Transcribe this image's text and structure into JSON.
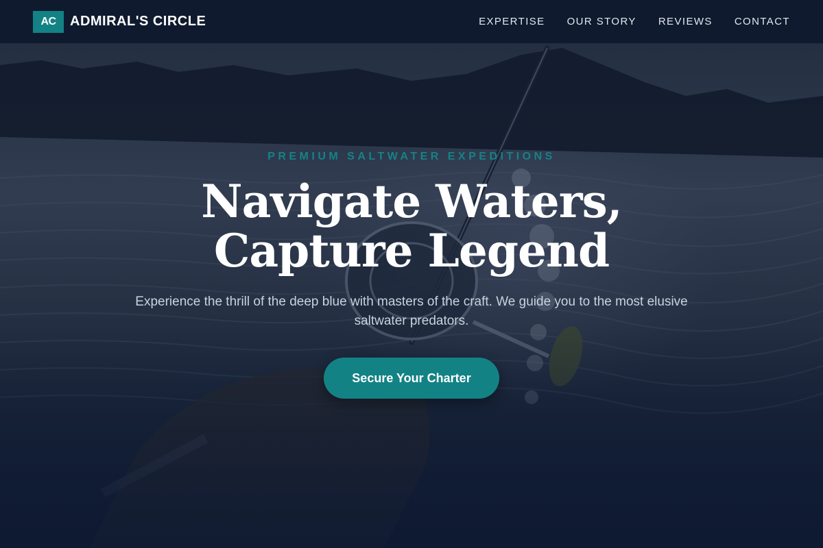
{
  "brand": {
    "mark": "AC",
    "name": "ADMIRAL'S CIRCLE"
  },
  "nav": {
    "items": [
      {
        "label": "EXPERTISE"
      },
      {
        "label": "OUR STORY"
      },
      {
        "label": "REVIEWS"
      },
      {
        "label": "CONTACT"
      }
    ]
  },
  "hero": {
    "eyebrow": "PREMIUM SALTWATER EXPEDITIONS",
    "title": "Navigate Waters, Capture Legend",
    "subtitle": "Experience the thrill of the deep blue with masters of the craft. We guide you to the most elusive saltwater predators.",
    "cta_label": "Secure Your Charter",
    "background_image": "fishing-rod-reel-over-water-photo"
  },
  "colors": {
    "accent": "#138285",
    "nav_bg": "#0e1a2e",
    "text_light": "#ffffff"
  }
}
